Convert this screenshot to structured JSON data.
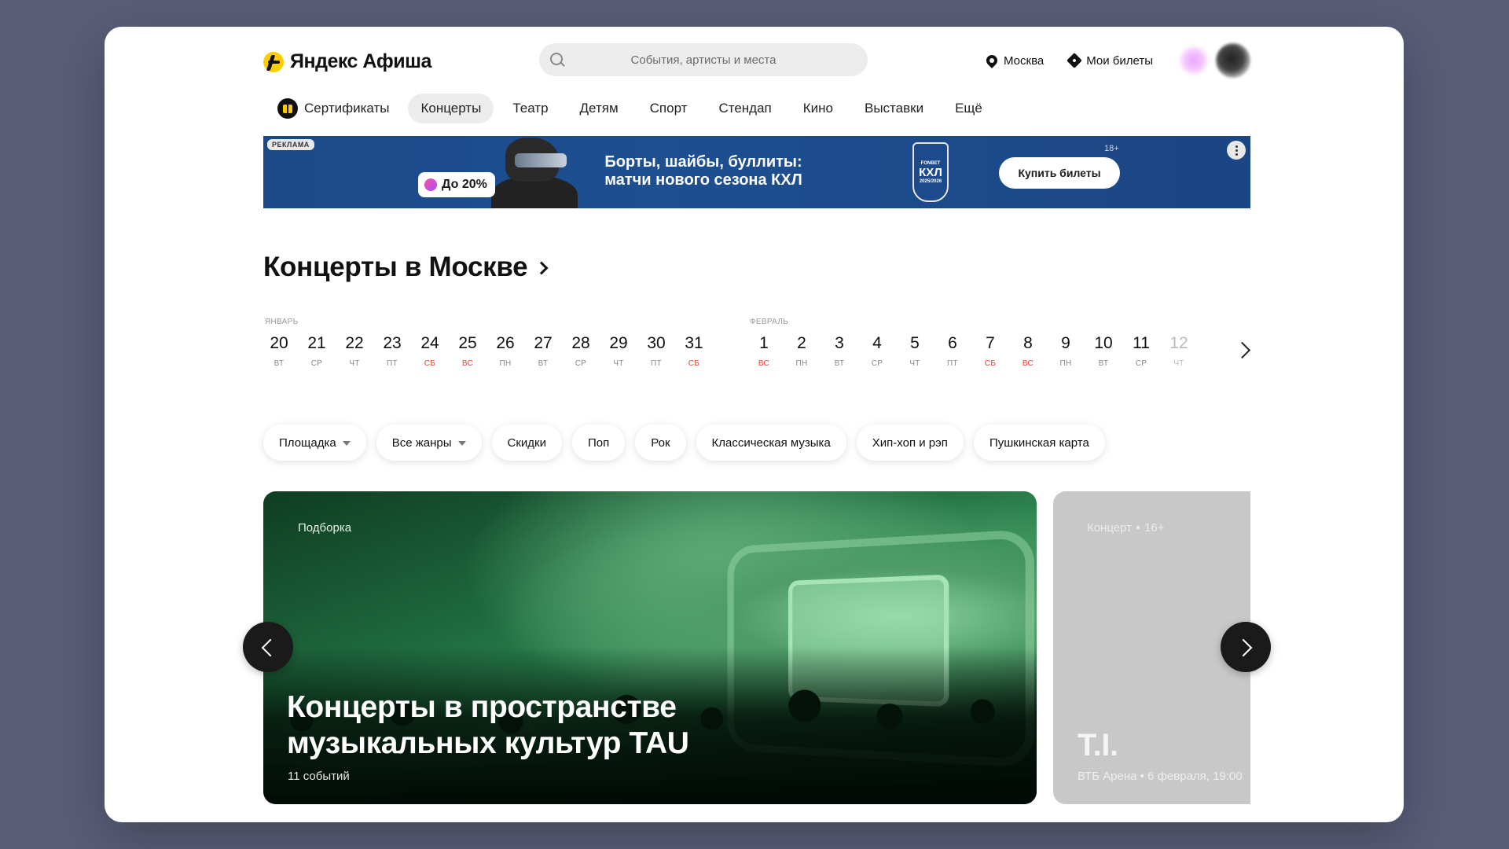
{
  "header": {
    "logo_text": "Яндекс Афиша",
    "search_placeholder": "События, артисты и места",
    "city": "Москва",
    "my_tickets": "Мои билеты"
  },
  "nav": {
    "items": [
      "Сертификаты",
      "Концерты",
      "Театр",
      "Детям",
      "Спорт",
      "Стендап",
      "Кино",
      "Выставки",
      "Ещё"
    ],
    "active": "Концерты"
  },
  "banner": {
    "ad_label": "РЕКЛАМА",
    "discount": "До 20%",
    "title": "Борты, шайбы, буллиты: матчи нового сезона КХЛ",
    "brand_top": "FONBET",
    "brand_main": "КХЛ",
    "season": "2025/2026",
    "age": "18+",
    "cta": "Купить билеты"
  },
  "section": {
    "title": "Концерты в Москве"
  },
  "calendar": {
    "months": [
      "ЯНВАРЬ",
      "ФЕВРАЛЬ"
    ],
    "dates": [
      {
        "day": "20",
        "wd": "ВТ",
        "weekend": false
      },
      {
        "day": "21",
        "wd": "СР",
        "weekend": false
      },
      {
        "day": "22",
        "wd": "ЧТ",
        "weekend": false
      },
      {
        "day": "23",
        "wd": "ПТ",
        "weekend": false
      },
      {
        "day": "24",
        "wd": "СБ",
        "weekend": true
      },
      {
        "day": "25",
        "wd": "ВС",
        "weekend": true
      },
      {
        "day": "26",
        "wd": "ПН",
        "weekend": false
      },
      {
        "day": "27",
        "wd": "ВТ",
        "weekend": false
      },
      {
        "day": "28",
        "wd": "СР",
        "weekend": false
      },
      {
        "day": "29",
        "wd": "ЧТ",
        "weekend": false
      },
      {
        "day": "30",
        "wd": "ПТ",
        "weekend": false
      },
      {
        "day": "31",
        "wd": "СБ",
        "weekend": true
      },
      {
        "day": "1",
        "wd": "ВС",
        "weekend": true
      },
      {
        "day": "2",
        "wd": "ПН",
        "weekend": false
      },
      {
        "day": "3",
        "wd": "ВТ",
        "weekend": false
      },
      {
        "day": "4",
        "wd": "СР",
        "weekend": false
      },
      {
        "day": "5",
        "wd": "ЧТ",
        "weekend": false
      },
      {
        "day": "6",
        "wd": "ПТ",
        "weekend": false
      },
      {
        "day": "7",
        "wd": "СБ",
        "weekend": true
      },
      {
        "day": "8",
        "wd": "ВС",
        "weekend": true
      },
      {
        "day": "9",
        "wd": "ПН",
        "weekend": false
      },
      {
        "day": "10",
        "wd": "ВТ",
        "weekend": false
      },
      {
        "day": "11",
        "wd": "СР",
        "weekend": false
      },
      {
        "day": "12",
        "wd": "ЧТ",
        "weekend": false,
        "faded": true
      }
    ]
  },
  "filters": [
    {
      "label": "Площадка",
      "dropdown": true
    },
    {
      "label": "Все жанры",
      "dropdown": true
    },
    {
      "label": "Скидки",
      "dropdown": false
    },
    {
      "label": "Поп",
      "dropdown": false
    },
    {
      "label": "Рок",
      "dropdown": false
    },
    {
      "label": "Классическая музыка",
      "dropdown": false
    },
    {
      "label": "Хип-хоп и рэп",
      "dropdown": false
    },
    {
      "label": "Пушкинская карта",
      "dropdown": false
    }
  ],
  "cards": {
    "main": {
      "tag": "Подборка",
      "title": "Концерты в пространстве музыкальных культур TAU",
      "subtitle": "11 событий"
    },
    "side": {
      "tag": "Концерт",
      "age": "16+",
      "title": "T.I.",
      "subtitle": "ВТБ Арена • 6 февраля, 19:00"
    }
  },
  "colors": {
    "page_background": "#5a5d78",
    "accent_yellow": "#ffcc00",
    "weekend_red": "#e8402f",
    "banner_blue": "#1d4f91"
  }
}
